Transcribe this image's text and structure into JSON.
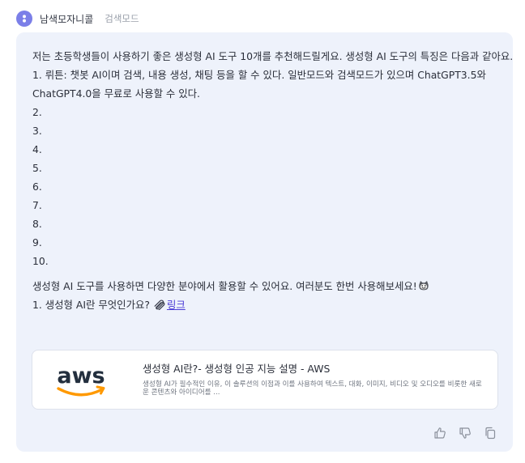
{
  "header": {
    "name": "남색모자니콜",
    "mode": "검색모드"
  },
  "message": {
    "intro": "저는 초등학생들이 사용하기 좋은 생성형 AI 도구 10개를 추천해드릴게요. 생성형 AI 도구의 특징은 다음과 같아요.",
    "item1_line1": "1. 뤼튼: 챗봇 AI이며 검색, 내용 생성, 채팅 등을 할 수 있다. 일반모드와 검색모드가 있으며 ChatGPT3.5와",
    "item1_line2": "ChatGPT4.0을 무료로 사용할 수 있다.",
    "numbers": [
      "2.",
      "3.",
      "4.",
      "5.",
      "6.",
      "7.",
      "8.",
      "9.",
      "10."
    ],
    "outro": "생성형 AI 도구를 사용하면 다양한 분야에서 활용할 수 있어요. 여러분도 한번 사용해보세요!",
    "source_prefix": "1. 생성형 AI란 무엇인가요?",
    "link_label": "링크"
  },
  "preview": {
    "logo_text": "aws",
    "title": "생성형 AI란?- 생성형 인공 지능 설명 - AWS",
    "description": "생성형 AI가 필수적인 이유, 이 솔루션의 이점과 이를 사용하여 텍스트, 대화, 이미지, 비디오 및 오디오를 비롯한 새로운 콘텐츠와 아이디어를 ..."
  },
  "icons": {
    "avatar": "avatar-icon",
    "emoji": "cat-face-icon",
    "link": "paperclip-icon",
    "like": "thumbs-up-icon",
    "dislike": "thumbs-down-icon",
    "copy": "copy-icon"
  },
  "colors": {
    "accent": "#7b7fe8",
    "card_bg": "#eef2fb",
    "link": "#4b3bd6",
    "aws_orange": "#ff9900",
    "aws_text": "#232f3e"
  }
}
